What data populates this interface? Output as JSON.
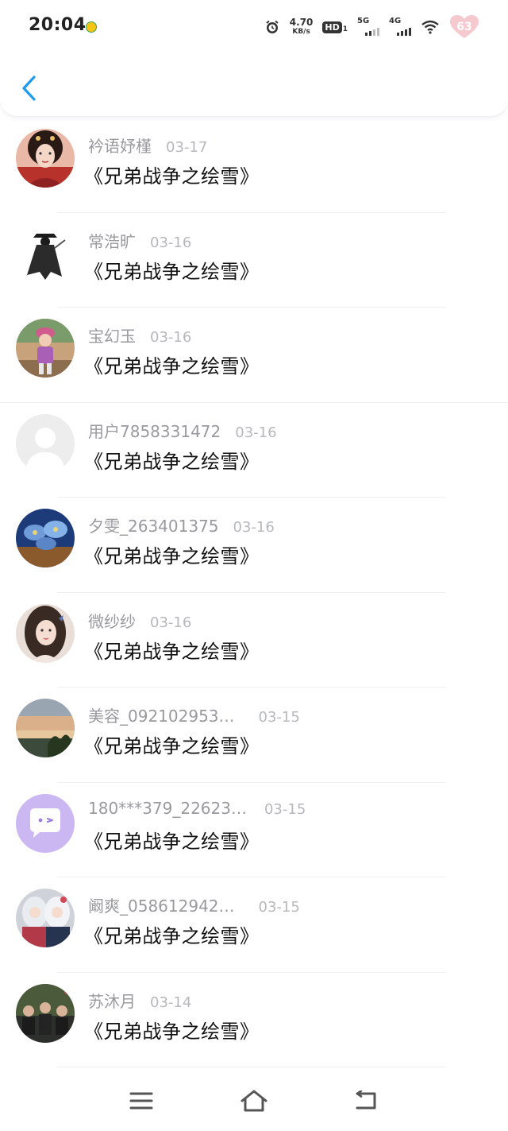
{
  "status_bar": {
    "time": "20:04",
    "net_speed_value": "4.70",
    "net_speed_unit": "KB/s",
    "hd_label": "HD",
    "hd_sub": "1",
    "sig1_label": "5G",
    "sig2_label": "4G",
    "battery": "63"
  },
  "icons": {
    "back": "chevron-left-icon",
    "menu": "menu-icon",
    "home": "home-icon",
    "back_nav": "return-icon"
  },
  "colors": {
    "accent": "#1e9bf0",
    "username": "#999a9e",
    "date": "#b6b8bc",
    "title": "#111111"
  },
  "comments": [
    {
      "user": "衿语妤槿",
      "date": "03-17",
      "text": "《兄弟战争之绘雪》",
      "avatar": "avatar-girl-red"
    },
    {
      "user": "常浩旷",
      "date": "03-16",
      "text": "《兄弟战争之绘雪》",
      "avatar": "avatar-dark-figure"
    },
    {
      "user": "宝幻玉",
      "date": "03-16",
      "text": "《兄弟战争之绘雪》",
      "avatar": "avatar-child"
    },
    {
      "user": "用户7858331472",
      "date": "03-16",
      "text": "《兄弟战争之绘雪》",
      "avatar": "avatar-default"
    },
    {
      "user": "夕雯_263401375",
      "date": "03-16",
      "text": "《兄弟战争之绘雪》",
      "avatar": "avatar-blue-flowers"
    },
    {
      "user": "微纱纱",
      "date": "03-16",
      "text": "《兄弟战争之绘雪》",
      "avatar": "avatar-girl-portrait"
    },
    {
      "user": "美容_092102953…",
      "date": "03-15",
      "text": "《兄弟战争之绘雪》",
      "avatar": "avatar-sunset"
    },
    {
      "user": "180***379_22623…",
      "date": "03-15",
      "text": "《兄弟战争之绘雪》",
      "avatar": "avatar-chat-bubble"
    },
    {
      "user": "阚爽_058612942…",
      "date": "03-15",
      "text": "《兄弟战争之绘雪》",
      "avatar": "avatar-anime"
    },
    {
      "user": "苏沐月",
      "date": "03-14",
      "text": "《兄弟战争之绘雪》",
      "avatar": "avatar-group"
    }
  ]
}
